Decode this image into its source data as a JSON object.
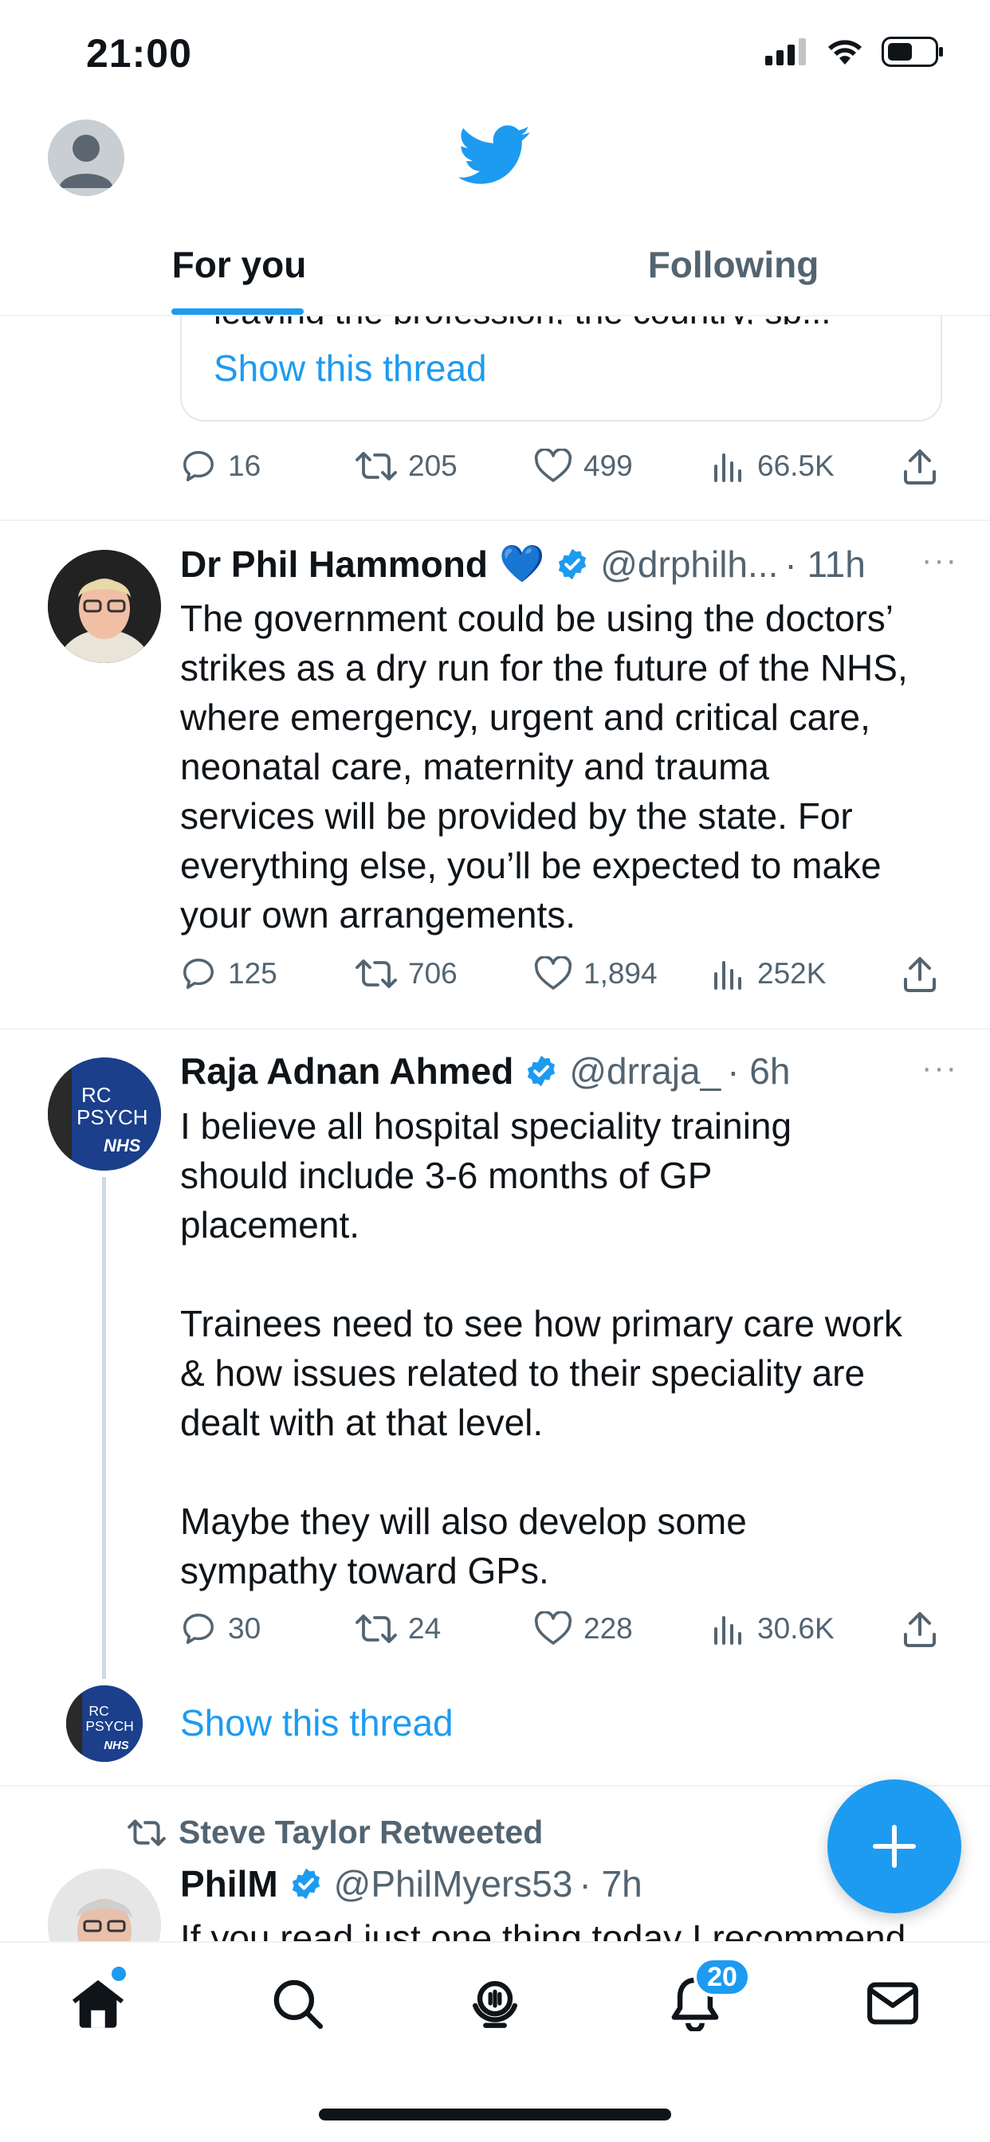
{
  "status_bar": {
    "time": "21:00"
  },
  "header": {
    "tabs": [
      {
        "label": "For you",
        "active": true
      },
      {
        "label": "Following",
        "active": false
      }
    ]
  },
  "quote_top": {
    "clipped_text": "leaving the profession, the country, sp...",
    "show_thread": "Show this thread",
    "counts": {
      "replies": "16",
      "retweets": "205",
      "likes": "499",
      "views": "66.5K"
    }
  },
  "tweets": [
    {
      "name": "Dr Phil Hammond",
      "emoji": "💙",
      "handle": "@drphilh...",
      "time": "· 11h",
      "text": "The government could be using the doctors’\nstrikes as a dry run for the future of the NHS,\nwhere emergency, urgent and critical care,\nneonatal care, maternity and trauma\nservices will be provided by the state. For\neverything else, you’ll be expected to make\nyour own arrangements.",
      "counts": {
        "replies": "125",
        "retweets": "706",
        "likes": "1,894",
        "views": "252K"
      }
    },
    {
      "name": "Raja Adnan Ahmed",
      "handle": "@drraja_",
      "time": "· 6h",
      "text": "I believe all hospital speciality training\nshould include 3-6 months of GP\nplacement.\n\nTrainees need to see how primary care work\n& how issues related to their speciality are\ndealt with at that level.\n\nMaybe they will also develop some\nsympathy toward GPs.",
      "counts": {
        "replies": "30",
        "retweets": "24",
        "likes": "228",
        "views": "30.6K"
      },
      "show_thread": "Show this thread",
      "avatar_text": {
        "line1": "RC",
        "line2": "PSYCH",
        "line3": "NHS"
      }
    },
    {
      "retweeted_by": "Steve Taylor Retweeted",
      "name": "PhilM",
      "handle": "@PhilMyers53",
      "time": "· 7h",
      "text": "If you read just one thing today I recommend"
    }
  ],
  "more_label": "···",
  "bottom_nav": {
    "notifications_badge": "20"
  },
  "colors": {
    "accent": "#1d9bf0",
    "text": "#0f1419",
    "secondary": "#536471",
    "divider": "#eff3f4"
  }
}
